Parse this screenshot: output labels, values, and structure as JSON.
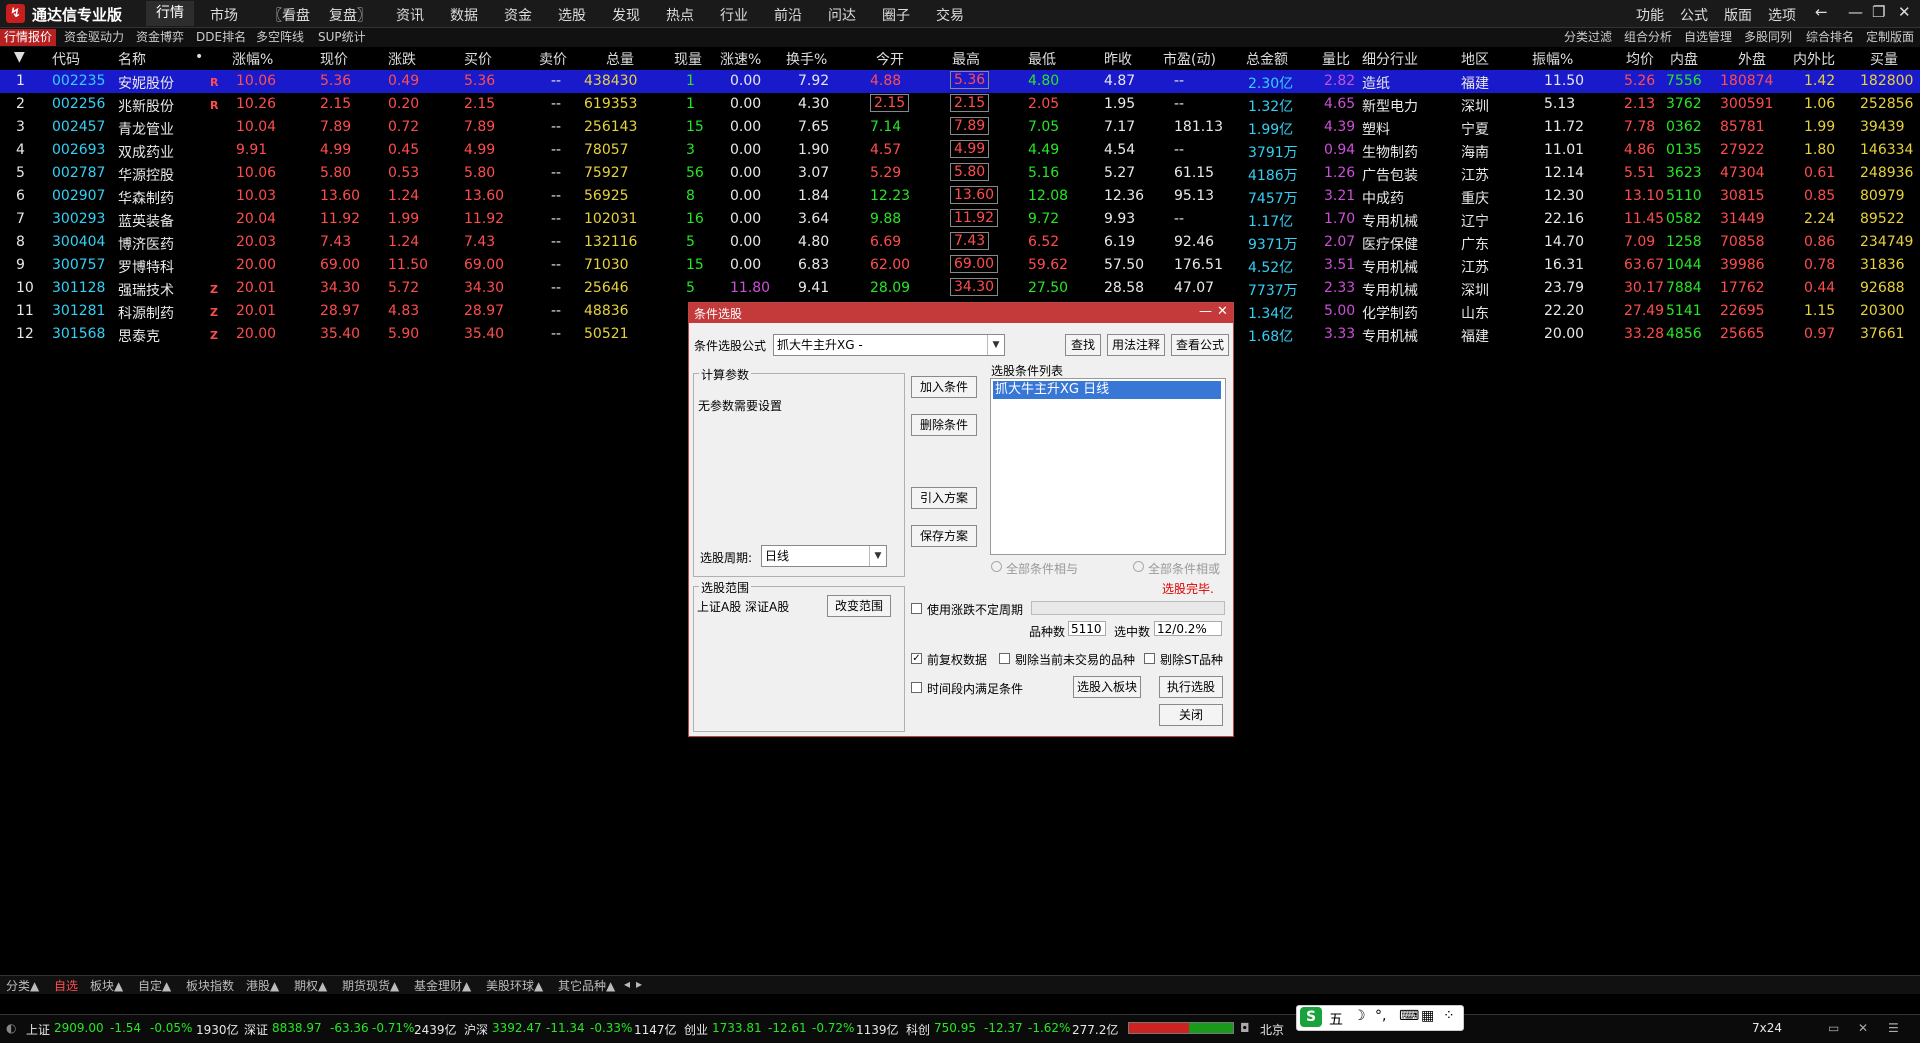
{
  "app": {
    "name": "通达信专业版",
    "menu": [
      "行情",
      "市场",
      "〖看盘",
      "复盘〗",
      "资讯",
      "数据",
      "资金",
      "选股",
      "发现",
      "热点",
      "行业",
      "前沿",
      "问达",
      "圈子",
      "交易"
    ],
    "right_menu": [
      "功能",
      "公式",
      "版面",
      "选项"
    ]
  },
  "subtabs": {
    "left": [
      "行情报价",
      "资金驱动力",
      "资金博弈",
      "DDE排名",
      "多空阵线",
      "SUP统计"
    ],
    "right": [
      "分类过滤",
      "组合分析",
      "自选管理",
      "多股同列",
      "综合排名",
      "定制版面"
    ]
  },
  "table": {
    "headers": [
      "代码",
      "名称",
      "•",
      "涨幅%",
      "现价",
      "涨跌",
      "买价",
      "卖价",
      "总量",
      "现量",
      "涨速%",
      "换手%",
      "今开",
      "最高",
      "最低",
      "昨收",
      "市盈(动)",
      "总金额",
      "量比",
      "细分行业",
      "地区",
      "振幅%",
      "均价",
      "内盘",
      "外盘",
      "内外比",
      "买量"
    ],
    "rows": [
      {
        "idx": "1",
        "code": "002235",
        "name": "安妮股份",
        "flag": "R",
        "chg_pct": "10.06",
        "price": "5.36",
        "chg": "0.49",
        "bid": "5.36",
        "ask": "--",
        "vol": "438430",
        "cur_vol": "1",
        "speed": "0.00",
        "turnover": "7.92",
        "open": "4.88",
        "high": "5.36",
        "low": "4.80",
        "prev": "4.87",
        "pe": "--",
        "amount": "2.30亿",
        "vol_ratio": "2.82",
        "industry": "造纸",
        "region": "福建",
        "amplitude": "11.50",
        "avg": "5.26",
        "inner": "7556",
        "outer": "180874",
        "io_ratio": "1.42",
        "bid_vol": "182800"
      },
      {
        "idx": "2",
        "code": "002256",
        "name": "兆新股份",
        "flag": "R",
        "chg_pct": "10.26",
        "price": "2.15",
        "chg": "0.20",
        "bid": "2.15",
        "ask": "--",
        "vol": "619353",
        "cur_vol": "1",
        "speed": "0.00",
        "turnover": "4.30",
        "open": "2.15",
        "high": "2.15",
        "low": "2.05",
        "prev": "1.95",
        "pe": "--",
        "amount": "1.32亿",
        "vol_ratio": "4.65",
        "industry": "新型电力",
        "region": "深圳",
        "amplitude": "5.13",
        "avg": "2.13",
        "inner": "3762",
        "outer": "300591",
        "io_ratio": "1.06",
        "bid_vol": "252856"
      },
      {
        "idx": "3",
        "code": "002457",
        "name": "青龙管业",
        "flag": "",
        "chg_pct": "10.04",
        "price": "7.89",
        "chg": "0.72",
        "bid": "7.89",
        "ask": "--",
        "vol": "256143",
        "cur_vol": "15",
        "speed": "0.00",
        "turnover": "7.65",
        "open": "7.14",
        "high": "7.89",
        "low": "7.05",
        "prev": "7.17",
        "pe": "181.13",
        "amount": "1.99亿",
        "vol_ratio": "4.39",
        "industry": "塑料",
        "region": "宁夏",
        "amplitude": "11.72",
        "avg": "7.78",
        "inner": "0362",
        "outer": "85781",
        "io_ratio": "1.99",
        "bid_vol": "39439"
      },
      {
        "idx": "4",
        "code": "002693",
        "name": "双成药业",
        "flag": "",
        "chg_pct": "9.91",
        "price": "4.99",
        "chg": "0.45",
        "bid": "4.99",
        "ask": "--",
        "vol": "78057",
        "cur_vol": "3",
        "speed": "0.00",
        "turnover": "1.90",
        "open": "4.57",
        "high": "4.99",
        "low": "4.49",
        "prev": "4.54",
        "pe": "--",
        "amount": "3791万",
        "vol_ratio": "0.94",
        "industry": "生物制药",
        "region": "海南",
        "amplitude": "11.01",
        "avg": "4.86",
        "inner": "0135",
        "outer": "27922",
        "io_ratio": "1.80",
        "bid_vol": "146334"
      },
      {
        "idx": "5",
        "code": "002787",
        "name": "华源控股",
        "flag": "",
        "chg_pct": "10.06",
        "price": "5.80",
        "chg": "0.53",
        "bid": "5.80",
        "ask": "--",
        "vol": "75927",
        "cur_vol": "56",
        "speed": "0.00",
        "turnover": "3.07",
        "open": "5.29",
        "high": "5.80",
        "low": "5.16",
        "prev": "5.27",
        "pe": "61.15",
        "amount": "4186万",
        "vol_ratio": "1.26",
        "industry": "广告包装",
        "region": "江苏",
        "amplitude": "12.14",
        "avg": "5.51",
        "inner": "3623",
        "outer": "47304",
        "io_ratio": "0.61",
        "bid_vol": "248936"
      },
      {
        "idx": "6",
        "code": "002907",
        "name": "华森制药",
        "flag": "",
        "chg_pct": "10.03",
        "price": "13.60",
        "chg": "1.24",
        "bid": "13.60",
        "ask": "--",
        "vol": "56925",
        "cur_vol": "8",
        "speed": "0.00",
        "turnover": "1.84",
        "open": "12.23",
        "high": "13.60",
        "low": "12.08",
        "prev": "12.36",
        "pe": "95.13",
        "amount": "7457万",
        "vol_ratio": "3.21",
        "industry": "中成药",
        "region": "重庆",
        "amplitude": "12.30",
        "avg": "13.10",
        "inner": "5110",
        "outer": "30815",
        "io_ratio": "0.85",
        "bid_vol": "80979"
      },
      {
        "idx": "7",
        "code": "300293",
        "name": "蓝英装备",
        "flag": "",
        "chg_pct": "20.04",
        "price": "11.92",
        "chg": "1.99",
        "bid": "11.92",
        "ask": "--",
        "vol": "102031",
        "cur_vol": "16",
        "speed": "0.00",
        "turnover": "3.64",
        "open": "9.88",
        "high": "11.92",
        "low": "9.72",
        "prev": "9.93",
        "pe": "--",
        "amount": "1.17亿",
        "vol_ratio": "1.70",
        "industry": "专用机械",
        "region": "辽宁",
        "amplitude": "22.16",
        "avg": "11.45",
        "inner": "0582",
        "outer": "31449",
        "io_ratio": "2.24",
        "bid_vol": "89522"
      },
      {
        "idx": "8",
        "code": "300404",
        "name": "博济医药",
        "flag": "",
        "chg_pct": "20.03",
        "price": "7.43",
        "chg": "1.24",
        "bid": "7.43",
        "ask": "--",
        "vol": "132116",
        "cur_vol": "5",
        "speed": "0.00",
        "turnover": "4.80",
        "open": "6.69",
        "high": "7.43",
        "low": "6.52",
        "prev": "6.19",
        "pe": "92.46",
        "amount": "9371万",
        "vol_ratio": "2.07",
        "industry": "医疗保健",
        "region": "广东",
        "amplitude": "14.70",
        "avg": "7.09",
        "inner": "1258",
        "outer": "70858",
        "io_ratio": "0.86",
        "bid_vol": "234749"
      },
      {
        "idx": "9",
        "code": "300757",
        "name": "罗博特科",
        "flag": "",
        "chg_pct": "20.00",
        "price": "69.00",
        "chg": "11.50",
        "bid": "69.00",
        "ask": "--",
        "vol": "71030",
        "cur_vol": "15",
        "speed": "0.00",
        "turnover": "6.83",
        "open": "62.00",
        "high": "69.00",
        "low": "59.62",
        "prev": "57.50",
        "pe": "176.51",
        "amount": "4.52亿",
        "vol_ratio": "3.51",
        "industry": "专用机械",
        "region": "江苏",
        "amplitude": "16.31",
        "avg": "63.67",
        "inner": "1044",
        "outer": "39986",
        "io_ratio": "0.78",
        "bid_vol": "31836"
      },
      {
        "idx": "10",
        "code": "301128",
        "name": "强瑞技术",
        "flag": "Z",
        "chg_pct": "20.01",
        "price": "34.30",
        "chg": "5.72",
        "bid": "34.30",
        "ask": "--",
        "vol": "25646",
        "cur_vol": "5",
        "speed": "11.80",
        "turnover": "9.41",
        "open": "28.09",
        "high": "34.30",
        "low": "27.50",
        "prev": "28.58",
        "pe": "47.07",
        "amount": "7737万",
        "vol_ratio": "2.33",
        "industry": "专用机械",
        "region": "深圳",
        "amplitude": "23.79",
        "avg": "30.17",
        "inner": "7884",
        "outer": "17762",
        "io_ratio": "0.44",
        "bid_vol": "92688"
      },
      {
        "idx": "11",
        "code": "301281",
        "name": "科源制药",
        "flag": "Z",
        "chg_pct": "20.01",
        "price": "28.97",
        "chg": "4.83",
        "bid": "28.97",
        "ask": "--",
        "vol": "48836",
        "cur_vol": "",
        "speed": "",
        "turnover": "",
        "open": "",
        "high": "",
        "low": "",
        "prev": "",
        "pe": "",
        "amount": "1.34亿",
        "vol_ratio": "5.00",
        "industry": "化学制药",
        "region": "山东",
        "amplitude": "22.20",
        "avg": "27.49",
        "inner": "5141",
        "outer": "22695",
        "io_ratio": "1.15",
        "bid_vol": "20300"
      },
      {
        "idx": "12",
        "code": "301568",
        "name": "思泰克",
        "flag": "Z",
        "chg_pct": "20.00",
        "price": "35.40",
        "chg": "5.90",
        "bid": "35.40",
        "ask": "--",
        "vol": "50521",
        "cur_vol": "",
        "speed": "",
        "turnover": "",
        "open": "",
        "high": "",
        "low": "",
        "prev": "",
        "pe": "",
        "amount": "1.68亿",
        "vol_ratio": "3.33",
        "industry": "专用机械",
        "region": "福建",
        "amplitude": "20.00",
        "avg": "33.28",
        "inner": "4856",
        "outer": "25665",
        "io_ratio": "0.97",
        "bid_vol": "37661"
      }
    ]
  },
  "dialog": {
    "title": "条件选股",
    "formula_label": "条件选股公式",
    "formula_value": "抓大牛主升XG -",
    "find": "查找",
    "usage": "用法注释",
    "view_formula": "查看公式",
    "params_group": "计算参数",
    "no_params": "无参数需要设置",
    "period_label": "选股周期:",
    "period_value": "日线",
    "add_condition": "加入条件",
    "delete_condition": "删除条件",
    "import_plan": "引入方案",
    "save_plan": "保存方案",
    "conditions_label": "选股条件列表",
    "condition_item": "抓大牛主升XG  日线",
    "all_and": "全部条件相与",
    "all_or": "全部条件相或",
    "done": "选股完毕.",
    "scope_group": "选股范围",
    "scope_value": "上证A股 深证A股",
    "change_scope": "改变范围",
    "use_indef_period": "使用涨跌不定周期",
    "count_label": "品种数",
    "count_value": "5110",
    "selected_label": "选中数",
    "selected_value": "12/0.2%",
    "forward_adjust": "前复权数据",
    "remove_not_trading": "剔除当前未交易的品种",
    "remove_st": "剔除ST品种",
    "time_period_cond": "时间段内满足条件",
    "to_block": "选股入板块",
    "execute": "执行选股",
    "close": "关闭"
  },
  "bottom_tabs": [
    "分类▲",
    "自选",
    "板块▲",
    "自定▲",
    "板块指数",
    "港股▲",
    "期权▲",
    "期货现货▲",
    "基金理财▲",
    "美股环球▲",
    "其它品种▲"
  ],
  "status": {
    "sh_label": "上证",
    "sh_val": "2909.00",
    "sh_chg": "-1.54",
    "sh_pct": "-0.05%",
    "sh_amt": "1930亿",
    "sz_label": "深证",
    "sz_val": "8838.97",
    "sz_chg": "-63.36",
    "sz_pct": "-0.71%",
    "sz_amt": "2439亿",
    "hs_label": "沪深",
    "hs_val": "3392.47",
    "hs_chg": "-11.34",
    "hs_pct": "-0.33%",
    "hs_amt": "1147亿",
    "cy_label": "创业",
    "cy_val": "1733.81",
    "cy_chg": "-12.61",
    "cy_pct": "-0.72%",
    "cy_amt": "1139亿",
    "kc_label": "科创",
    "kc_val": "750.95",
    "kc_chg": "-12.37",
    "kc_pct": "-1.62%",
    "kc_amt": "277.2亿",
    "server": "北京",
    "clock": "7x24"
  },
  "ime": {
    "mode": "五",
    "logo": "S"
  }
}
